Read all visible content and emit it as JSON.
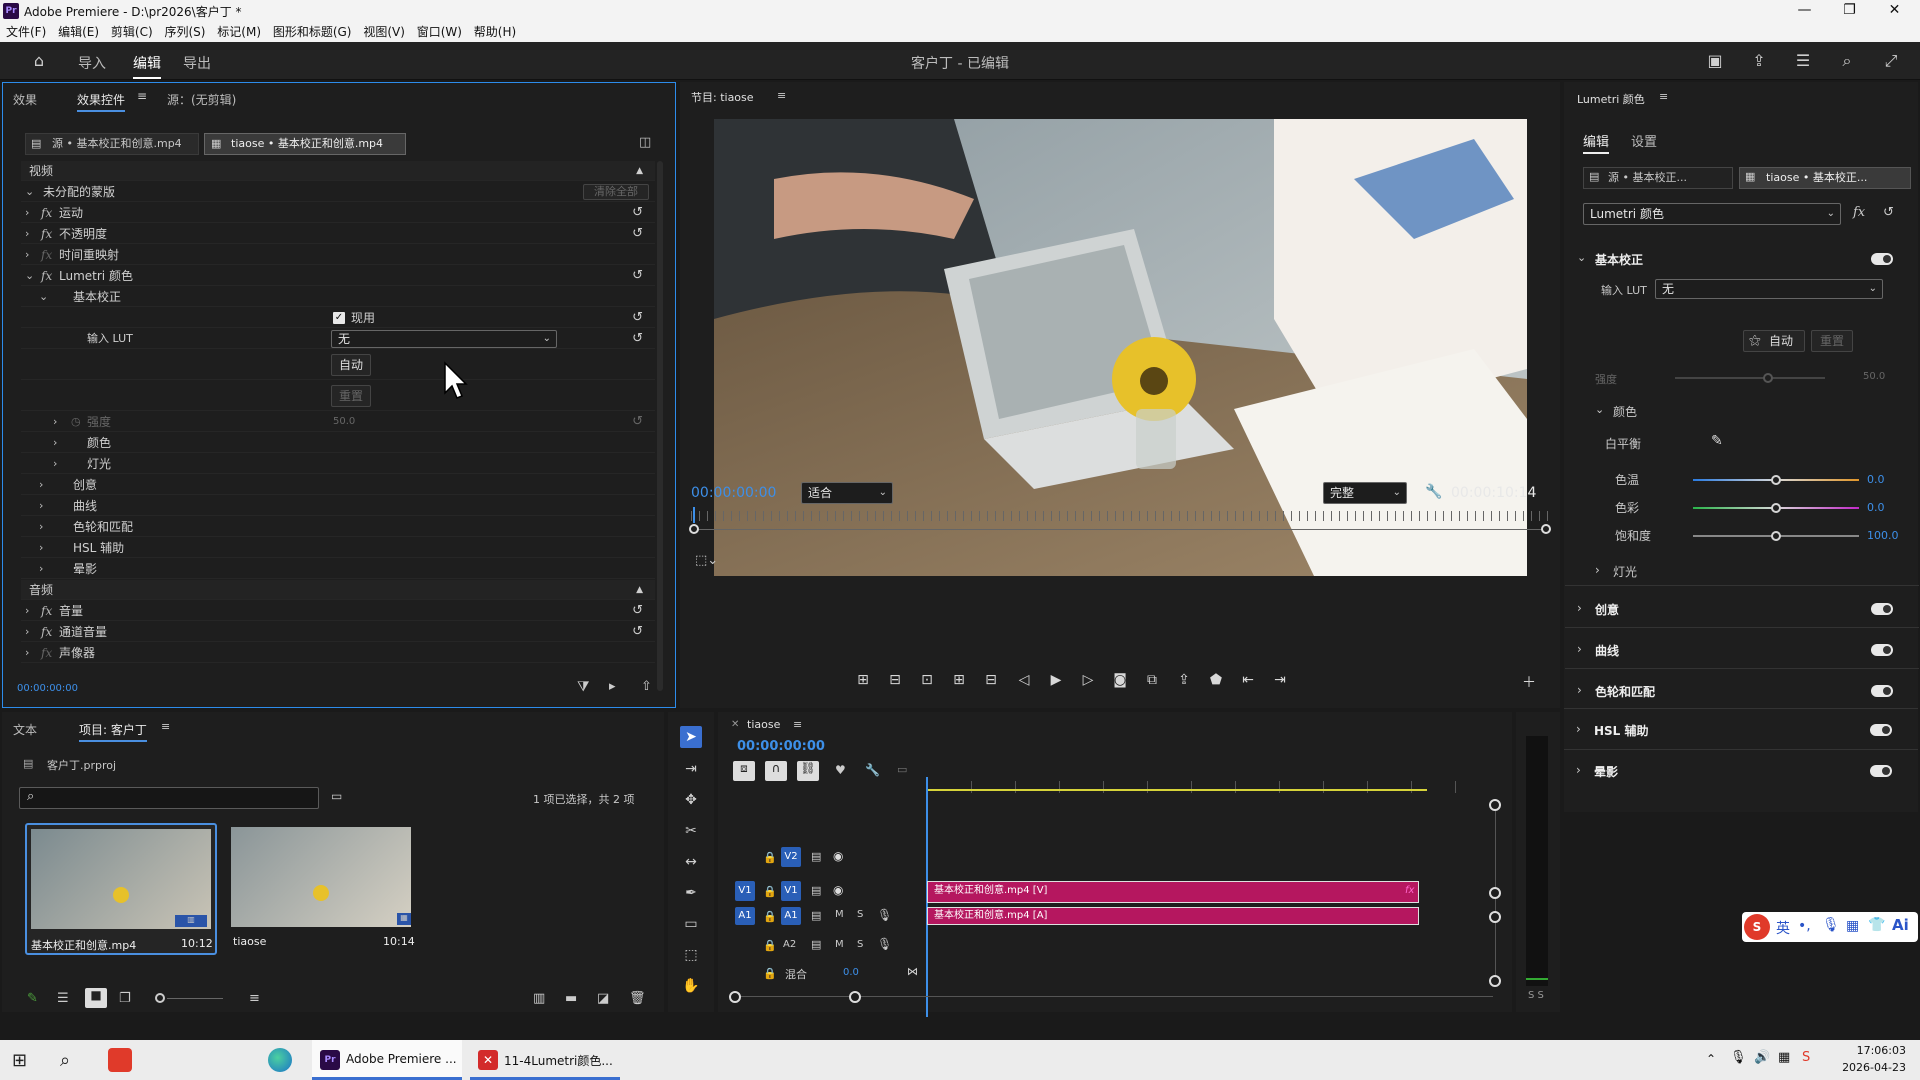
{
  "window": {
    "title": "Adobe Premiere - D:\\pr2026\\客户丁 *",
    "logo": "Pr",
    "min": "—",
    "max": "❐",
    "close": "✕"
  },
  "menu": [
    "文件(F)",
    "编辑(E)",
    "剪辑(C)",
    "序列(S)",
    "标记(M)",
    "图形和标题(G)",
    "视图(V)",
    "窗口(W)",
    "帮助(H)"
  ],
  "header": {
    "tabs": [
      "导入",
      "编辑",
      "导出"
    ],
    "project_status": "客户丁 - 已编辑"
  },
  "effect_controls": {
    "tabs": [
      "效果",
      "效果控件",
      "源：(无剪辑)"
    ],
    "source_tab": "源 • 基本校正和创意.mp4",
    "target_tab": "tiaose • 基本校正和创意.mp4",
    "video_header": "视频",
    "mask_row": "未分配的蒙版",
    "clear_all": "清除全部",
    "motion": "运动",
    "opacity": "不透明度",
    "time_remap": "时间重映射",
    "lumetri": "Lumetri 颜色",
    "basic": "基本校正",
    "apply_label": "现用",
    "lut_label": "输入 LUT",
    "lut_value": "无",
    "auto": "自动",
    "reset": "重置",
    "intensity": "强度",
    "intensity_value": "50.0",
    "color": "颜色",
    "light": "灯光",
    "creative": "创意",
    "curves": "曲线",
    "color_wheels": "色轮和匹配",
    "hsl": "HSL 辅助",
    "vignette": "晕影",
    "audio_header": "音频",
    "volume": "音量",
    "channel_volume": "通道音量",
    "panner": "声像器",
    "timecode": "00:00:00:00"
  },
  "program": {
    "title": "节目: tiaose",
    "timecode": "00:00:00:00",
    "fit": "适合",
    "quality": "完整",
    "duration": "00:00:10:14"
  },
  "lumetri": {
    "title": "Lumetri 颜色",
    "tabs": [
      "编辑",
      "设置"
    ],
    "source_clip": "源 • 基本校正...",
    "seq_clip": "tiaose • 基本校正...",
    "effect": "Lumetri 颜色",
    "basic": "基本校正",
    "lut_label": "输入 LUT",
    "lut_value": "无",
    "auto": "自动",
    "reset": "重置",
    "intensity": "强度",
    "intensity_value": "50.0",
    "color": "颜色",
    "white_balance": "白平衡",
    "temp": "色温",
    "temp_value": "0.0",
    "tint": "色彩",
    "tint_value": "0.0",
    "saturation": "饱和度",
    "saturation_value": "100.0",
    "light": "灯光",
    "sections": [
      "创意",
      "曲线",
      "色轮和匹配",
      "HSL 辅助",
      "晕影"
    ]
  },
  "project": {
    "tabs": [
      "文本",
      "项目: 客户丁"
    ],
    "file": "客户丁.prproj",
    "search_placeholder": "",
    "selection": "1 项已选择，共 2 项",
    "items": [
      {
        "name": "基本校正和创意.mp4",
        "duration": "10:12"
      },
      {
        "name": "tiaose",
        "duration": "10:14"
      }
    ]
  },
  "timeline": {
    "name": "tiaose",
    "timecode": "00:00:00:00",
    "tracks": {
      "v2": "V2",
      "v1": "V1",
      "a1": "A1",
      "a2": "A2",
      "mix": "混合",
      "mix_value": "0.0",
      "m": "M",
      "s": "S"
    },
    "video_clip": "基本校正和创意.mp4 [V]",
    "audio_clip": "基本校正和创意.mp4 [A]",
    "meter_label": "S S"
  },
  "ime": {
    "label": "英"
  },
  "taskbar": {
    "apps": [
      "Adobe Premiere ...",
      "11-4Lumetri颜色..."
    ],
    "time": "17:06:03",
    "date": "2026-04-23"
  },
  "colors": {
    "accent": "#2d8ceb",
    "clip": "#b5175f",
    "timecode": "#3d8fe8"
  }
}
